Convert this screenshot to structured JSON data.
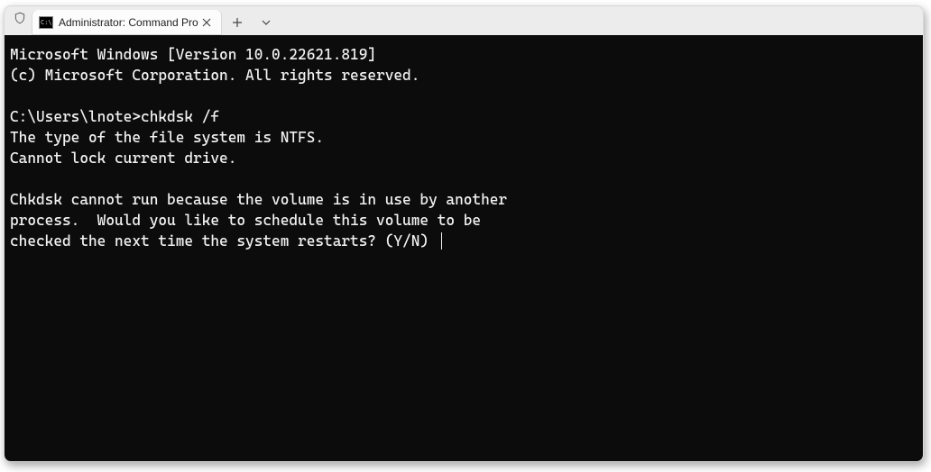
{
  "tab": {
    "title": "Administrator: Command Pro"
  },
  "terminal": {
    "line1": "Microsoft Windows [Version 10.0.22621.819]",
    "line2": "(c) Microsoft Corporation. All rights reserved.",
    "blank1": "",
    "prompt": "C:\\Users\\lnote>",
    "command": "chkdsk /f",
    "out1": "The type of the file system is NTFS.",
    "out2": "Cannot lock current drive.",
    "blank2": "",
    "out3": "Chkdsk cannot run because the volume is in use by another",
    "out4": "process.  Would you like to schedule this volume to be",
    "out5": "checked the next time the system restarts? (Y/N) "
  }
}
